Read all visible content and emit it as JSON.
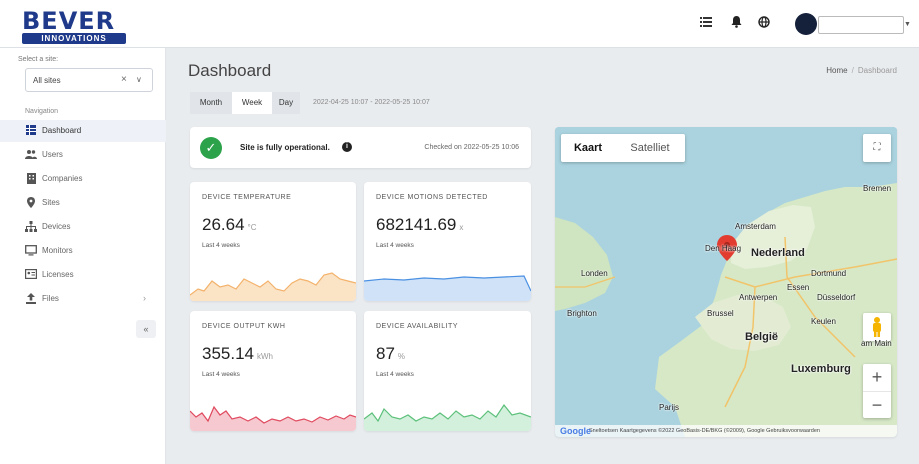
{
  "logo": {
    "main": "BEVER",
    "sub": "INNOVATIONS"
  },
  "sidebar": {
    "site_label": "Select a site:",
    "site_value": "All sites",
    "nav_label": "Navigation",
    "items": [
      {
        "label": "Dashboard",
        "icon": "grid-icon",
        "active": true
      },
      {
        "label": "Users",
        "icon": "users-icon"
      },
      {
        "label": "Companies",
        "icon": "building-icon"
      },
      {
        "label": "Sites",
        "icon": "map-pin-icon"
      },
      {
        "label": "Devices",
        "icon": "sitemap-icon"
      },
      {
        "label": "Monitors",
        "icon": "monitor-icon"
      },
      {
        "label": "Licenses",
        "icon": "license-icon"
      },
      {
        "label": "Files",
        "icon": "upload-icon",
        "has_children": true
      }
    ],
    "collapse_glyph": "«"
  },
  "header": {
    "title": "Dashboard",
    "breadcrumb": {
      "home": "Home",
      "current": "Dashboard"
    }
  },
  "tabs": [
    {
      "label": "Month"
    },
    {
      "label": "Week",
      "active": true
    },
    {
      "label": "Day"
    }
  ],
  "date_range": "2022-04-25 10:07 - 2022-05-25 10:07",
  "status": {
    "message": "Site is fully operational.",
    "checked": "Checked on 2022-05-25 10:06"
  },
  "metrics": [
    {
      "title": "DEVICE TEMPERATURE",
      "value": "26.64",
      "unit": "°C",
      "sub": "Last 4 weeks",
      "color": "#f3b26b",
      "fill": "#fbe3c6"
    },
    {
      "title": "DEVICE MOTIONS DETECTED",
      "value": "682141.69",
      "unit": "x",
      "sub": "Last 4 weeks",
      "color": "#4a90e2",
      "fill": "#cfe2f8"
    },
    {
      "title": "DEVICE OUTPUT KWH",
      "value": "355.14",
      "unit": "kWh",
      "sub": "Last 4 weeks",
      "color": "#e04a5f",
      "fill": "#f6c8cf"
    },
    {
      "title": "DEVICE AVAILABILITY",
      "value": "87",
      "unit": "%",
      "sub": "Last 4 weeks",
      "color": "#5cc07a",
      "fill": "#d3f0dc"
    }
  ],
  "map": {
    "type_map": "Kaart",
    "type_satellite": "Satelliet",
    "zoom_in": "+",
    "zoom_out": "−",
    "labels": {
      "nederland": "Nederland",
      "belgie": "België",
      "luxemburg": "Luxemburg",
      "amsterdam": "Amsterdam",
      "den_haag": "Den Haag",
      "londen": "Londen",
      "antwerpen": "Antwerpen",
      "brussel": "Brussel",
      "dortmund": "Dortmund",
      "dusseldorf": "Düsseldorf",
      "essen": "Essen",
      "keulen": "Keulen",
      "parijs": "Parijs",
      "bremen": "Bremen",
      "brighton": "Brighton",
      "frankfurt": "am Main"
    },
    "attribution": "Sneltoetsen   Kaartgegevens ©2022 GeoBasis-DE/BKG (©2009), Google   Gebruiksvoorwaarden",
    "google": "Google"
  }
}
